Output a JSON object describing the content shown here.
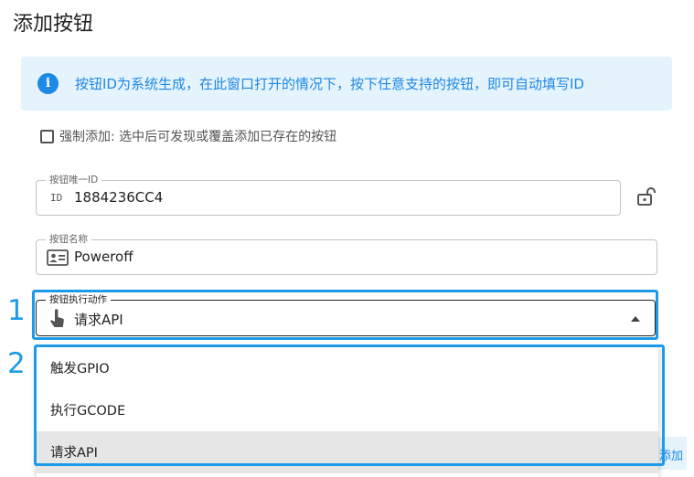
{
  "page": {
    "title": "添加按钮"
  },
  "info": {
    "text": "按钮ID为系统生成，在此窗口打开的情况下，按下任意支持的按钮，即可自动填写ID"
  },
  "force_add": {
    "label": "强制添加: 选中后可发现或覆盖添加已存在的按钮",
    "checked": false
  },
  "button_id": {
    "label": "按钮唯一ID",
    "icon_text": "ID",
    "value": "1884236CC4"
  },
  "button_name": {
    "label": "按钮名称",
    "value": "Poweroff"
  },
  "action": {
    "label": "按钮执行动作",
    "value": "请求API"
  },
  "dropdown": {
    "options": [
      "触发GPIO",
      "执行GCODE",
      "请求API"
    ],
    "selected": "请求API"
  },
  "behind_button": {
    "label": "添加"
  },
  "annotations": {
    "marker1": "1",
    "marker2": "2"
  },
  "colors": {
    "accent": "#1e88e5",
    "highlight": "#1e9be8",
    "info_bg": "#e5f3fc"
  }
}
